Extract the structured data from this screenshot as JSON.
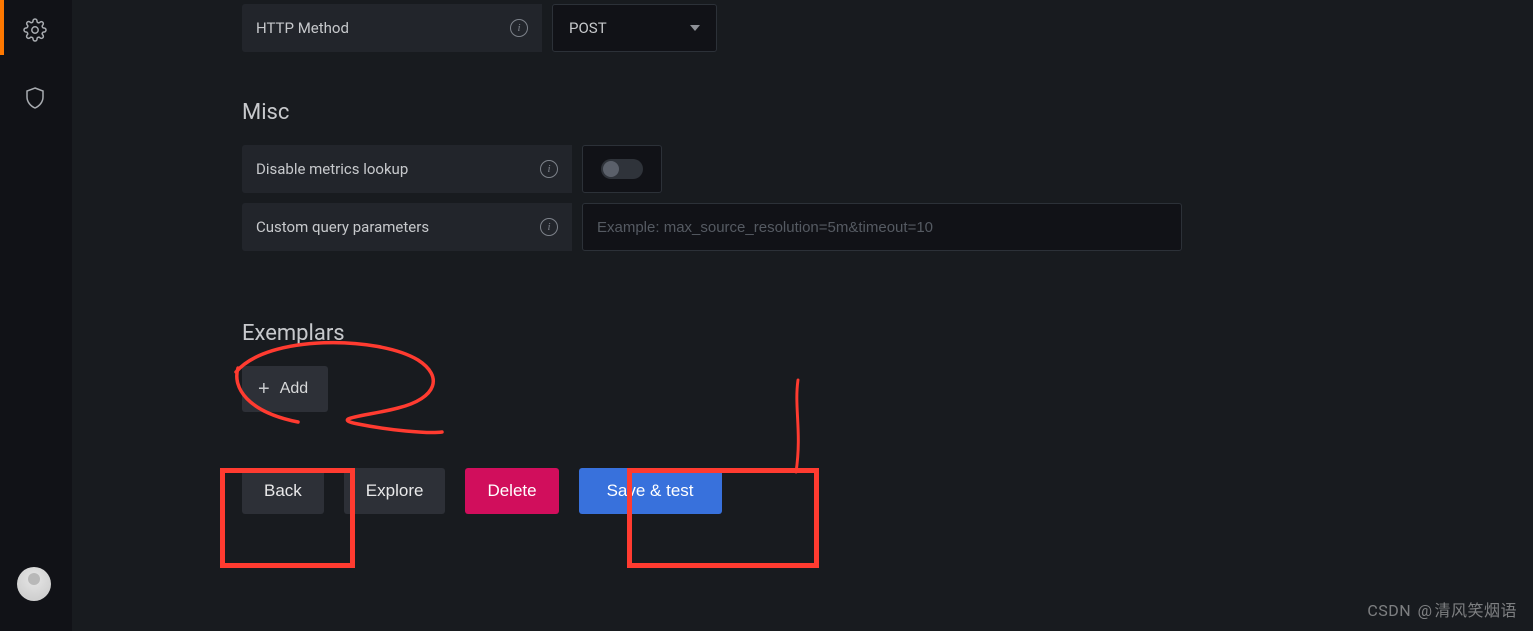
{
  "sidebar": {
    "icons": {
      "settings": "gear-icon",
      "shield": "shield-icon"
    }
  },
  "form": {
    "http_method": {
      "label": "HTTP Method",
      "selected": "POST"
    },
    "misc_title": "Misc",
    "disable_metrics": {
      "label": "Disable metrics lookup",
      "on": false
    },
    "custom_query": {
      "label": "Custom query parameters",
      "placeholder": "Example: max_source_resolution=5m&timeout=10",
      "value": ""
    },
    "exemplars_title": "Exemplars",
    "add_label": "Add"
  },
  "buttons": {
    "back": "Back",
    "explore": "Explore",
    "delete": "Delete",
    "save_test": "Save & test"
  },
  "watermark": {
    "prefix": "CSDN",
    "at": "@",
    "author": "清风笑烟语"
  },
  "colors": {
    "accent_orange": "#ff7800",
    "accent_red": "#ff3b30",
    "danger": "#d10e5c",
    "primary": "#3871dc",
    "panel": "#181b1f",
    "field": "#22252b"
  }
}
